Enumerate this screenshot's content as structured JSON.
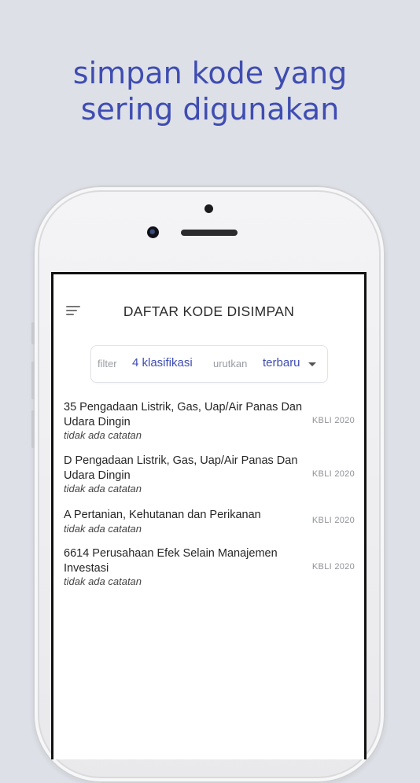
{
  "headline": {
    "line1": "simpan kode yang",
    "line2": "sering digunakan"
  },
  "header": {
    "title": "DAFTAR KODE DISIMPAN",
    "menu_icon": "hamburger-icon"
  },
  "filter_bar": {
    "filter_label": "filter",
    "filter_value": "4 klasifikasi",
    "sort_label": "urutkan",
    "sort_value": "terbaru",
    "sort_icon": "caret-down-icon"
  },
  "items": [
    {
      "title": "35 Pengadaan Listrik, Gas, Uap/Air Panas Dan Udara Dingin",
      "note": "tidak ada catatan",
      "tag": "KBLI 2020"
    },
    {
      "title": "D Pengadaan Listrik, Gas, Uap/Air Panas Dan Udara Dingin",
      "note": "tidak ada catatan",
      "tag": "KBLI 2020"
    },
    {
      "title": "A Pertanian, Kehutanan dan Perikanan",
      "note": "tidak ada catatan",
      "tag": "KBLI 2020"
    },
    {
      "title": "6614 Perusahaan Efek Selain Manajemen Investasi",
      "note": "tidak ada catatan",
      "tag": "KBLI 2020"
    }
  ],
  "colors": {
    "background": "#dde0e7",
    "accent": "#3f4db1"
  }
}
